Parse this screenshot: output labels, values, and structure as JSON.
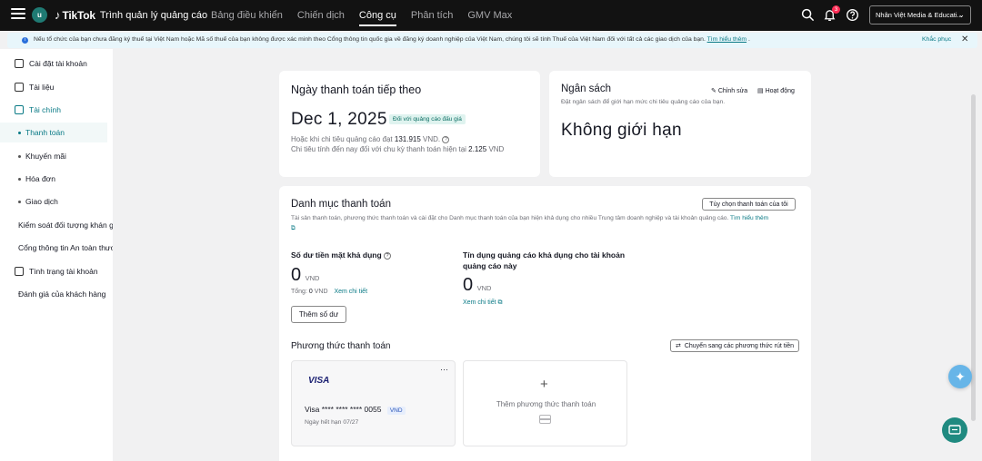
{
  "topbar": {
    "avatar_letter": "u",
    "brand_name": "TikTok",
    "brand_sub": "Trình quản lý quảng cáo",
    "nav": [
      "Bảng điều khiển",
      "Chiến dịch",
      "Công cụ",
      "Phân tích",
      "GMV Max"
    ],
    "notification_count": "3",
    "account": "Nhân Việt Media & Educati..."
  },
  "notice": {
    "text": "Nếu tổ chức của bạn chưa đăng ký thuế tại Việt Nam hoặc Mã số thuế của bạn không được xác minh theo Cổng thông tin quốc gia về đăng ký doanh nghiệp của Việt Nam, chúng tôi sẽ tính Thuế của Việt Nam đối với tất cả các giao dịch của bạn.",
    "link": "Tìm hiểu thêm",
    "dismiss": "Khắc phục"
  },
  "sidebar": {
    "items": [
      {
        "label": "Cài đặt tài khoản"
      },
      {
        "label": "Tài liệu"
      },
      {
        "label": "Tài chính"
      },
      {
        "label": "Thanh toán"
      },
      {
        "label": "Khuyến mãi"
      },
      {
        "label": "Hóa đơn"
      },
      {
        "label": "Giao dịch"
      },
      {
        "label": "Kiểm soát đối tượng khán giả"
      },
      {
        "label": "Cổng thông tin An toàn thương hiệu"
      },
      {
        "label": "Tình trạng tài khoản"
      },
      {
        "label": "Đánh giá của khách hàng"
      }
    ]
  },
  "next_payment": {
    "title": "Ngày thanh toán tiếp theo",
    "date": "Dec 1, 2025",
    "tag": "Đối với quảng cáo đấu giá",
    "line1_prefix": "Hoặc khi chi tiêu quảng cáo đạt",
    "line1_amount": "131.915",
    "line1_suffix": "VND.",
    "line2_prefix": "Chi tiêu tính đến nay đối với chu kỳ thanh toán hiện tại",
    "line2_amount": "2.125",
    "line2_suffix": "VND"
  },
  "budget": {
    "title": "Ngân sách",
    "edit": "Chỉnh sửa",
    "activity": "Hoạt động",
    "desc": "Đặt ngân sách để giới hạn mức chi tiêu quảng cáo của bạn.",
    "value": "Không giới hạn"
  },
  "portfolio": {
    "title": "Danh mục thanh toán",
    "options_button": "Tùy chọn thanh toán của tôi",
    "desc": "Tài sản thanh toán, phương thức thanh toán và cài đặt cho Danh mục thanh toán của bạn hiện khả dụng cho nhiều Trung tâm doanh nghiệp và tài khoản quảng cáo.",
    "learn_more": "Tìm hiểu thêm",
    "cash_label": "Số dư tiền mặt khả dụng",
    "cash_value": "0",
    "cash_currency": "VND",
    "total_label": "Tổng:",
    "total_value": "0",
    "total_currency": "VND",
    "view_detail": "Xem chi tiết",
    "credit_label": "Tín dụng quảng cáo khả dụng cho tài khoản quảng cáo này",
    "credit_value": "0",
    "credit_currency": "VND",
    "credit_view": "Xem chi tiết",
    "add_balance": "Thêm số dư"
  },
  "methods": {
    "title": "Phương thức thanh toán",
    "switch_button": "Chuyển sang các phương thức rút tiền",
    "card_brand": "VISA",
    "card_number": "Visa **** **** **** 0055",
    "card_currency": "VND",
    "card_expiry": "Ngày hết hạn 07/27",
    "card_menu": "···",
    "add_method": "Thêm phương thức thanh toán"
  },
  "colors": {
    "accent": "#0a7a86",
    "topbar": "#121212",
    "badge": "#fe2c55"
  }
}
